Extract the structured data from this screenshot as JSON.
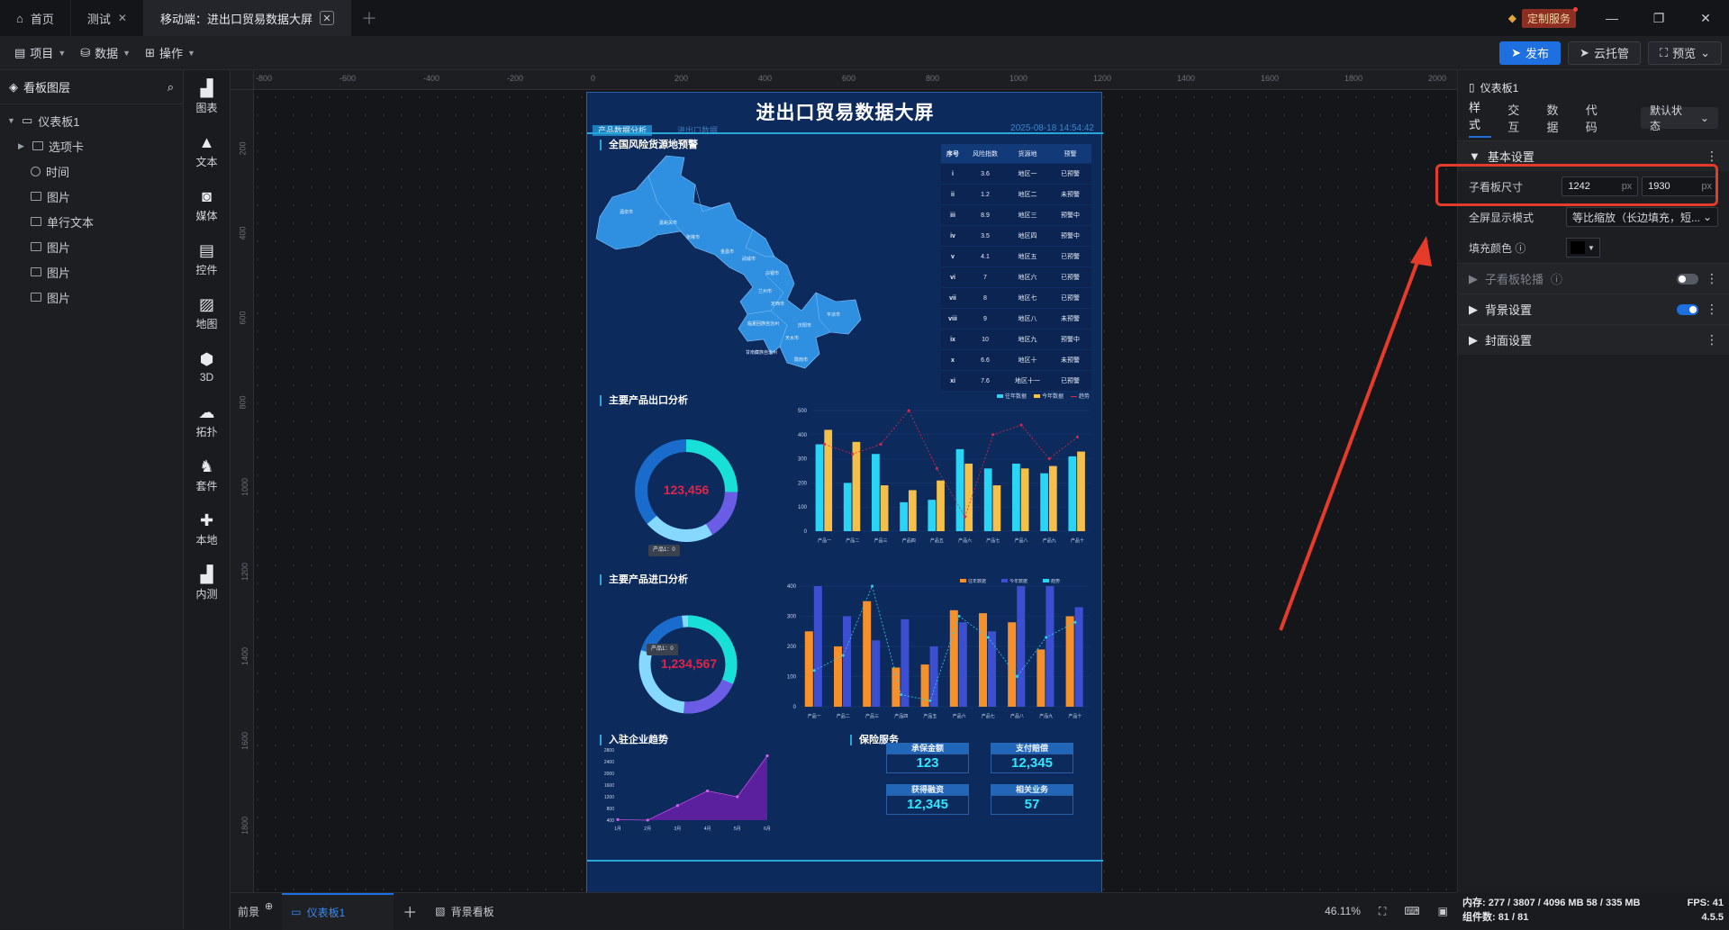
{
  "tabs": [
    {
      "label": "首页"
    },
    {
      "label": "测试"
    },
    {
      "label": "移动端：进出口贸易数据大屏"
    }
  ],
  "header": {
    "custom_service": "定制服务"
  },
  "toolbar": {
    "menus": [
      "项目",
      "数据",
      "操作"
    ],
    "publish": "发布",
    "cloud_host": "云托管",
    "preview": "预览"
  },
  "layers": {
    "title": "看板图层",
    "root": "仪表板1",
    "items": [
      "选项卡",
      "时间",
      "图片",
      "单行文本",
      "图片",
      "图片",
      "图片"
    ]
  },
  "palette": [
    "图表",
    "文本",
    "媒体",
    "控件",
    "地图",
    "3D",
    "拓扑",
    "套件",
    "本地",
    "内测"
  ],
  "ruler": {
    "h": [
      "-800",
      "-600",
      "-400",
      "-200",
      "0",
      "200",
      "400",
      "600",
      "800",
      "1000",
      "1200",
      "1400",
      "1600",
      "1800",
      "2000"
    ],
    "v": [
      "200",
      "400",
      "600",
      "800",
      "1000",
      "1200",
      "1400",
      "1600",
      "1800"
    ]
  },
  "dashboard": {
    "title": "进出口贸易数据大屏",
    "tab_active": "产品数据分析",
    "tab_other": "进出口数据",
    "datetime": "2025-08-18 14:54:42",
    "sections": {
      "risk": "全国风险货源地预警",
      "export": "主要产品出口分析",
      "import": "主要产品进口分析",
      "enterprise": "入驻企业趋势",
      "insurance": "保险服务"
    },
    "table_headers": [
      "序号",
      "风险指数",
      "货源地",
      "预警"
    ],
    "table_rows": [
      [
        "i",
        "3.6",
        "地区一",
        "已预警"
      ],
      [
        "ii",
        "1.2",
        "地区二",
        "未预警"
      ],
      [
        "iii",
        "8.9",
        "地区三",
        "预警中"
      ],
      [
        "iv",
        "3.5",
        "地区四",
        "预警中"
      ],
      [
        "v",
        "4.1",
        "地区五",
        "已预警"
      ],
      [
        "vi",
        "7",
        "地区六",
        "已预警"
      ],
      [
        "vii",
        "8",
        "地区七",
        "已预警"
      ],
      [
        "viii",
        "9",
        "地区八",
        "未预警"
      ],
      [
        "ix",
        "10",
        "地区九",
        "预警中"
      ],
      [
        "x",
        "6.6",
        "地区十",
        "未预警"
      ],
      [
        "xi",
        "7.6",
        "地区十一",
        "已预警"
      ]
    ],
    "map_labels": [
      "酒泉市",
      "嘉峪关市",
      "张掖市",
      "金昌市",
      "武威市",
      "白银市",
      "兰州市",
      "定西市",
      "临夏回族自治州",
      "甘南藏族自治州",
      "平凉市",
      "庆阳市",
      "天水市",
      "陇南市"
    ],
    "legend1": [
      "往年数据",
      "今年数据",
      "趋势"
    ],
    "export_donut": "123,456",
    "import_donut": "1,234,567",
    "tooltip_label": "产品1：0",
    "insurance_cards": [
      {
        "label": "承保金额",
        "value": "123"
      },
      {
        "label": "支付赔偿",
        "value": "12,345"
      },
      {
        "label": "获得融资",
        "value": "12,345"
      },
      {
        "label": "相关业务",
        "value": "57"
      }
    ]
  },
  "chart_data": [
    {
      "type": "bar",
      "title": "主要产品出口分析",
      "categories": [
        "产品一",
        "产品二",
        "产品三",
        "产品四",
        "产品五",
        "产品六",
        "产品七",
        "产品八",
        "产品九",
        "产品十"
      ],
      "ylim": [
        0,
        500
      ],
      "yticks": [
        "0",
        "100",
        "200",
        "300",
        "400",
        "500"
      ],
      "series": [
        {
          "name": "往年数据",
          "values": [
            360,
            200,
            320,
            120,
            130,
            340,
            260,
            280,
            240,
            310
          ]
        },
        {
          "name": "今年数据",
          "values": [
            420,
            370,
            190,
            170,
            210,
            280,
            190,
            260,
            270,
            330
          ]
        },
        {
          "name": "趋势",
          "values": [
            360,
            320,
            360,
            500,
            260,
            60,
            400,
            440,
            300,
            390
          ]
        }
      ]
    },
    {
      "type": "bar",
      "title": "主要产品进口分析",
      "categories": [
        "产品一",
        "产品二",
        "产品三",
        "产品四",
        "产品五",
        "产品六",
        "产品七",
        "产品八",
        "产品九",
        "产品十"
      ],
      "ylim": [
        0,
        400
      ],
      "yticks": [
        "0",
        "100",
        "200",
        "300",
        "400"
      ],
      "series": [
        {
          "name": "往年数据",
          "values": [
            250,
            200,
            350,
            130,
            140,
            320,
            310,
            280,
            190,
            300
          ]
        },
        {
          "name": "今年数据",
          "values": [
            400,
            300,
            220,
            290,
            200,
            280,
            250,
            400,
            400,
            330
          ]
        },
        {
          "name": "趋势",
          "values": [
            120,
            170,
            400,
            40,
            20,
            300,
            230,
            100,
            230,
            280
          ]
        }
      ]
    },
    {
      "type": "area",
      "title": "入驻企业趋势",
      "categories": [
        "1月",
        "2月",
        "3月",
        "4月",
        "5月",
        "6月"
      ],
      "ylim": [
        400,
        2800
      ],
      "yticks": [
        "400",
        "800",
        "1200",
        "1600",
        "2000",
        "2400",
        "2800"
      ],
      "values": [
        420,
        400,
        900,
        1400,
        1200,
        2600
      ]
    }
  ],
  "props": {
    "title": "仪表板1",
    "tabs": [
      "样式",
      "交互",
      "数据",
      "代码"
    ],
    "state": "默认状态",
    "basic_group": "基本设置",
    "size_label": "子看板尺寸",
    "width": "1242",
    "height": "1930",
    "unit": "px",
    "fullscreen_label": "全屏显示模式",
    "fullscreen_value": "等比缩放（长边填充，短...",
    "fill_label": "填充颜色",
    "carousel": "子看板轮播",
    "bg_group": "背景设置",
    "cover_group": "封面设置"
  },
  "bottom": {
    "front": "前景",
    "board_tab": "仪表板1",
    "bg_board": "背景看板",
    "zoom": "46.11%"
  },
  "status": {
    "memory": "内存:  277 / 3807 / 4096 MB  58 / 335 MB",
    "fps": "FPS:  41",
    "components": "组件数: 81 / 81",
    "version": "4.5.5"
  }
}
